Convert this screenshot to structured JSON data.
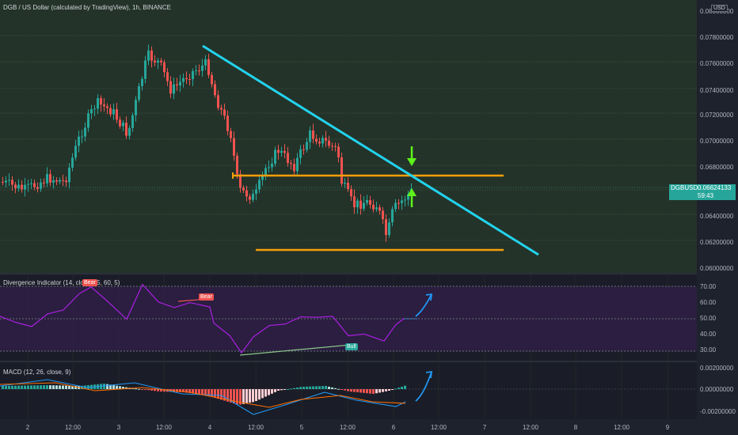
{
  "chart": {
    "title": "DGB / US Dollar (calculated by TradingView), 1h, BINANCE",
    "currency_badge": "USD",
    "price_axis": [
      "0.08000000",
      "0.07800000",
      "0.07600000",
      "0.07400000",
      "0.07200000",
      "0.07000000",
      "0.06800000",
      "0.06400000",
      "0.06200000",
      "0.06000000"
    ],
    "last_price": {
      "symbol": "DGBUSD",
      "price": "0.06624133",
      "countdown": "59:43"
    }
  },
  "indicators": {
    "rsi": {
      "title": "Divergence Indicator (14, clo",
      "title_tail": "5, 60, 5)",
      "axis": [
        "70.00",
        "60.00",
        "50.00",
        "40.00",
        "30.00"
      ],
      "bear_label": "Bear",
      "bull_label": "Bull"
    },
    "macd": {
      "title": "MACD (12, 26, close, 9)",
      "axis": [
        "0.00200000",
        "0.00000000",
        "-0.00200000"
      ]
    }
  },
  "time_axis": [
    "2",
    "12:00",
    "3",
    "12:00",
    "4",
    "12:00",
    "5",
    "12:00",
    "6",
    "12:00",
    "7",
    "12:00",
    "8",
    "12:00",
    "9"
  ],
  "colors": {
    "up": "#26a69a",
    "down": "#ef5350",
    "trendline": "#22d3ee",
    "support": "#f59e0b",
    "arrow_green": "#5ef21a",
    "arrow_blue": "#2196f3",
    "rsi_line": "#a21fd8"
  }
}
